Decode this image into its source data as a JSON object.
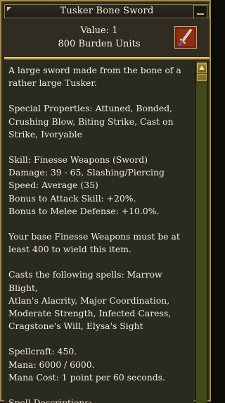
{
  "window": {
    "title": "Tusker Bone Sword"
  },
  "header": {
    "value_text": "Value: 1",
    "burden_text": "800 Burden Units",
    "item_icon": "sword-icon"
  },
  "description": {
    "intro": [
      "A large sword made from the bone of a",
      "rather large Tusker."
    ],
    "special": [
      "Special Properties: Attuned, Bonded,",
      "Crushing Blow, Biting Strike, Cast on",
      "Strike, Ivoryable"
    ],
    "stats": [
      "Skill: Finesse Weapons (Sword)",
      "Damage: 39 - 65, Slashing/Piercing",
      "Speed: Average (35)",
      "Bonus to Attack Skill: +20%.",
      "Bonus to Melee Defense: +10.0%."
    ],
    "requirement": [
      "Your base Finesse Weapons must be at",
      "least 400 to wield this item."
    ],
    "spells": [
      "Casts the following spells: Marrow Blight,",
      "Atlan's Alacrity, Major Coordination,",
      "Moderate Strength, Infected Caress,",
      "Cragstone's Will, Elysa's Sight"
    ],
    "mana": [
      "Spellcraft: 450.",
      "Mana: 6000 / 6000.",
      "Mana Cost: 1 point per 60 seconds."
    ],
    "spell_descriptions_heading": "Spell Descriptions:"
  }
}
